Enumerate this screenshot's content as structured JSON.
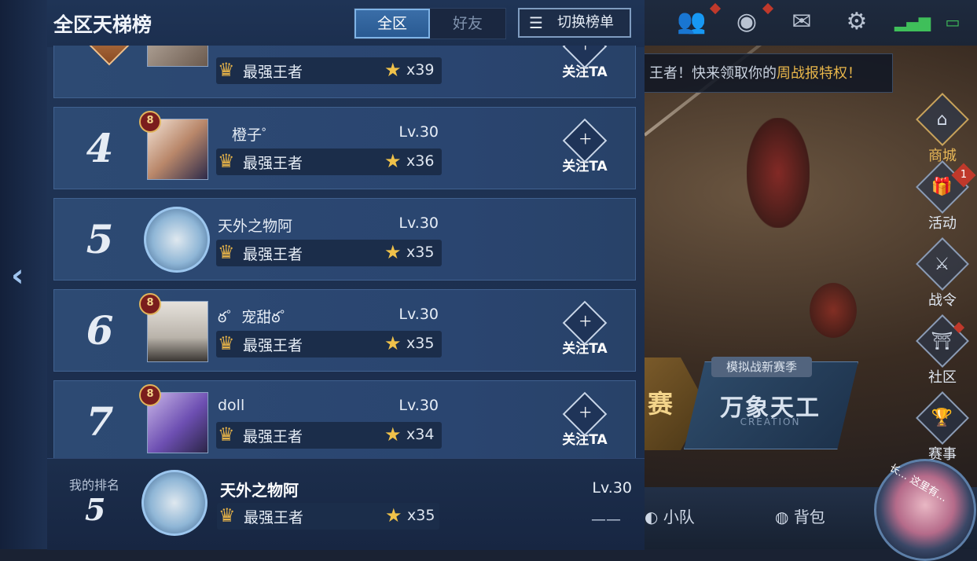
{
  "header": {
    "title": "全区天梯榜",
    "tabs": [
      "全区",
      "好友"
    ],
    "switch_label": "切换榜单"
  },
  "rows": [
    {
      "rank": "3",
      "name": "",
      "level": "",
      "tier": "最强王者",
      "stars": "x39",
      "follow": "关注TA",
      "badge": ""
    },
    {
      "rank": "4",
      "name": "橙子゜",
      "level": "Lv.30",
      "tier": "最强王者",
      "stars": "x36",
      "follow": "关注TA",
      "badge": "8"
    },
    {
      "rank": "5",
      "name": "天外之物阿",
      "level": "Lv.30",
      "tier": "最强王者",
      "stars": "x35",
      "follow": "",
      "badge": ""
    },
    {
      "rank": "6",
      "name": "ఠ゜宠甜ఠ゜",
      "level": "Lv.30",
      "tier": "最强王者",
      "stars": "x35",
      "follow": "关注TA",
      "badge": "8"
    },
    {
      "rank": "7",
      "name": "doll",
      "level": "Lv.30",
      "tier": "最强王者",
      "stars": "x34",
      "follow": "关注TA",
      "badge": "8"
    }
  ],
  "my_rank": {
    "label": "我的排名",
    "rank": "5",
    "name": "天外之物阿",
    "level": "Lv.30",
    "tier": "最强王者",
    "stars": "x35",
    "change": "——"
  },
  "notice": {
    "prefix": "王者！快来领取你的",
    "highlight": "周战报特权！"
  },
  "sidebar": [
    {
      "label": "商城",
      "icon": "shop-icon"
    },
    {
      "label": "活动",
      "icon": "gift-icon",
      "badge": "1"
    },
    {
      "label": "战令",
      "icon": "battle-pass-icon"
    },
    {
      "label": "社区",
      "icon": "community-icon"
    },
    {
      "label": "赛事",
      "icon": "trophy-icon"
    }
  ],
  "mode": {
    "tag": "模拟战新赛季",
    "title": "万象天工",
    "subtitle": "CREATION",
    "left_title": "赛"
  },
  "bottom_nav": [
    "小队",
    "背包"
  ],
  "hero_text": "长… 这里有…"
}
